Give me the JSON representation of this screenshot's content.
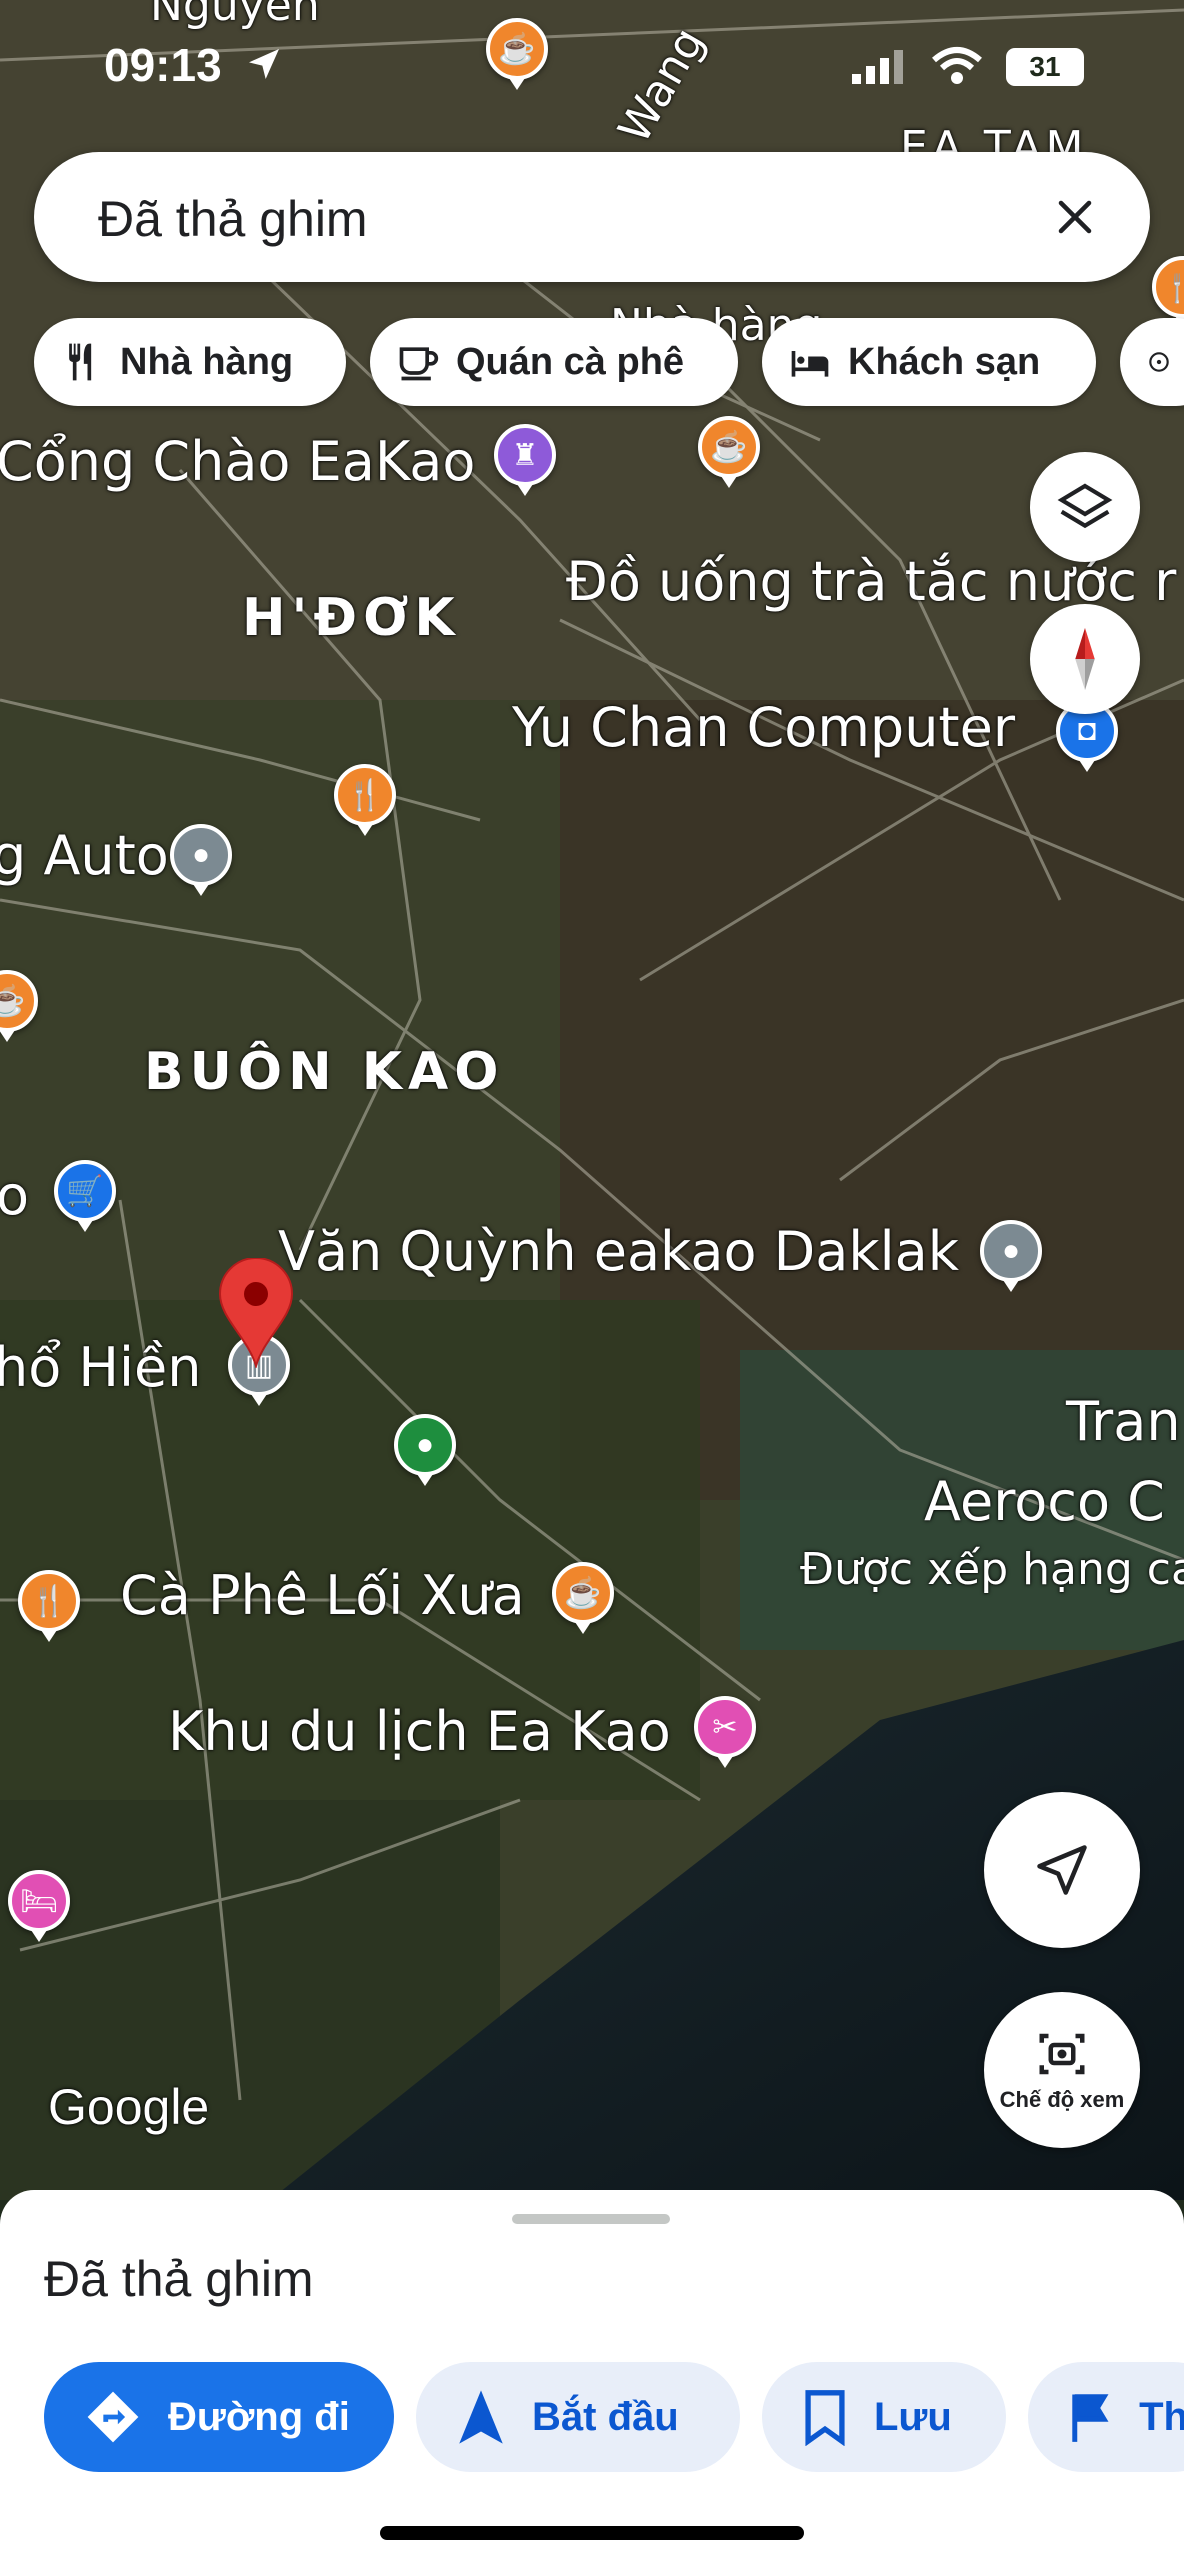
{
  "status_bar": {
    "time": "09:13",
    "battery": "31"
  },
  "search": {
    "text": "Đã thả ghim"
  },
  "chips": [
    {
      "label": "Nhà hàng",
      "icon": "restaurant-icon"
    },
    {
      "label": "Quán cà phê",
      "icon": "coffee-icon"
    },
    {
      "label": "Khách sạn",
      "icon": "hotel-icon"
    }
  ],
  "map": {
    "labels": {
      "top_partial": "Nguyễn",
      "road_wang": "Wang",
      "ea_tam": "EA TAM",
      "cong_chao": "Cổng Chào EaKao",
      "nha_hang": "Nhà hàng",
      "do_uong": "Đồ uống trà tắc nước r",
      "h_dok": "H'ĐƠK",
      "yu_chan": "Yu Chan Computer",
      "auto": "g Auto",
      "buon_kao": "BUÔN KAO",
      "van_quynh": "Văn Quỳnh eakao Daklak",
      "pho_hien": "hổ Hiền",
      "tran": "Tran",
      "aeroco": "Aeroco C",
      "duoc_xep_hang": "Được xếp hạng ca",
      "ca_phe_loi_xua": "Cà Phê Lối Xưa",
      "khu_du_lich": "Khu du lịch Ea Kao",
      "o_left": "o",
      "google": "Google"
    }
  },
  "view_mode_label": "Chế độ xem",
  "sheet": {
    "title": "Đã thả ghim",
    "actions": [
      {
        "label": "Đường đi",
        "icon": "directions-icon"
      },
      {
        "label": "Bắt đầu",
        "icon": "navigation-arrow-icon"
      },
      {
        "label": "Lưu",
        "icon": "bookmark-icon"
      },
      {
        "label": "Th",
        "icon": "flag-icon"
      }
    ]
  }
}
